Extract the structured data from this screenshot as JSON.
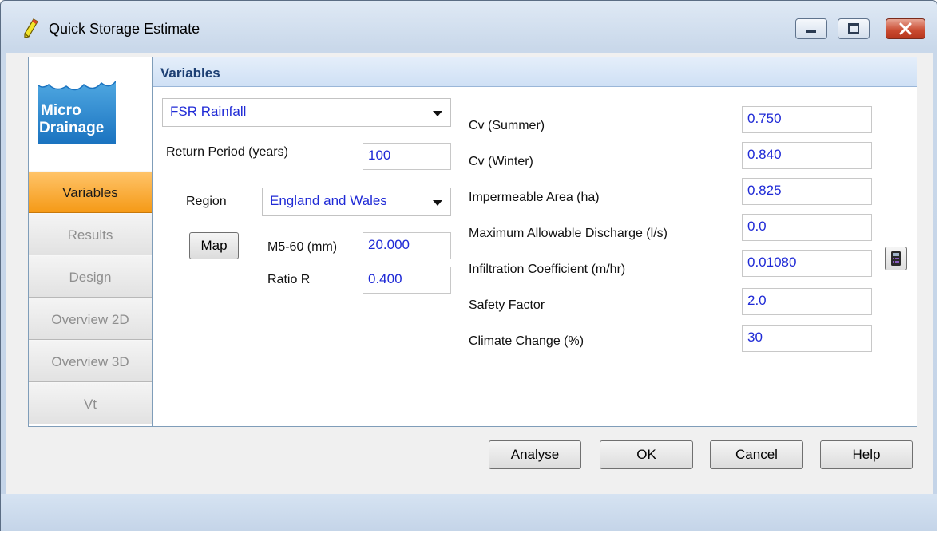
{
  "window": {
    "title": "Quick Storage Estimate"
  },
  "logo": {
    "text_line1": "Micro",
    "text_line2": "Drainage"
  },
  "nav": {
    "items": [
      {
        "label": "Variables",
        "active": true
      },
      {
        "label": "Results",
        "active": false
      },
      {
        "label": "Design",
        "active": false
      },
      {
        "label": "Overview 2D",
        "active": false
      },
      {
        "label": "Overview 3D",
        "active": false
      },
      {
        "label": "Vt",
        "active": false
      }
    ]
  },
  "panel": {
    "title": "Variables"
  },
  "rainfall": {
    "method": "FSR Rainfall",
    "return_period_label": "Return Period (years)",
    "return_period_value": "100",
    "region_label": "Region",
    "region_value": "England and Wales",
    "map_button": "Map",
    "m560_label": "M5-60 (mm)",
    "m560_value": "20.000",
    "ratio_label": "Ratio R",
    "ratio_value": "0.400"
  },
  "params": [
    {
      "label": "Cv (Summer)",
      "value": "0.750"
    },
    {
      "label": "Cv (Winter)",
      "value": "0.840"
    },
    {
      "label": "Impermeable Area (ha)",
      "value": "0.825"
    },
    {
      "label": "Maximum Allowable Discharge (l/s)",
      "value": "0.0"
    },
    {
      "label": "Infiltration Coefficient (m/hr)",
      "value": "0.01080"
    },
    {
      "label": "Safety Factor",
      "value": "2.0"
    },
    {
      "label": "Climate Change (%)",
      "value": "30"
    }
  ],
  "buttons": {
    "analyse": "Analyse",
    "ok": "OK",
    "cancel": "Cancel",
    "help": "Help"
  },
  "colors": {
    "accent_orange": "#f59a17",
    "value_blue": "#1f2ad6",
    "header_text": "#1d3f73"
  }
}
